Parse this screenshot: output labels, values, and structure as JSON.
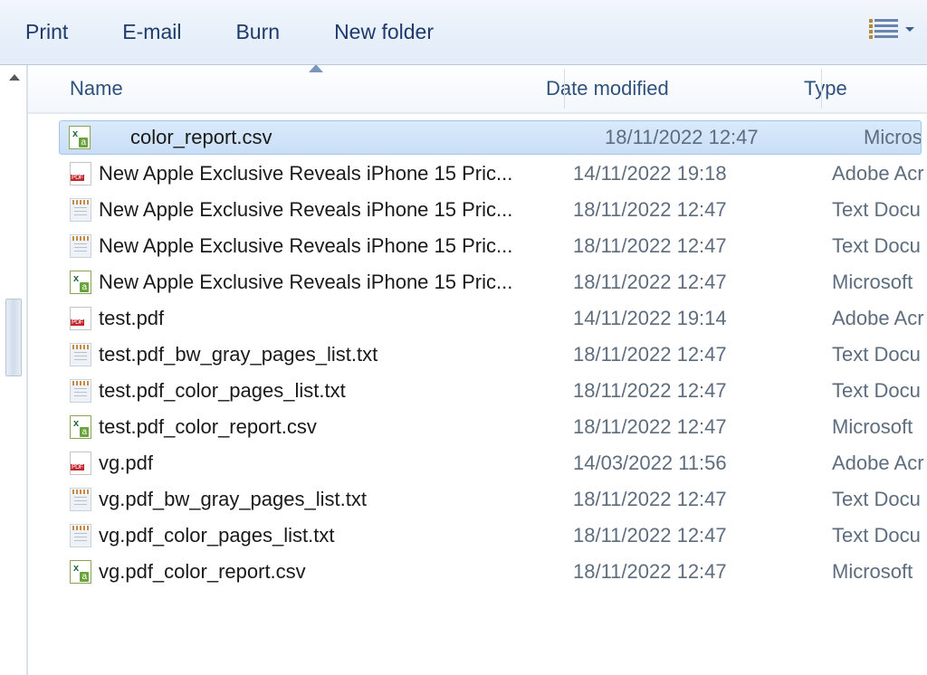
{
  "toolbar": {
    "print": "Print",
    "email": "E-mail",
    "burn": "Burn",
    "new_folder": "New folder"
  },
  "columns": {
    "name": "Name",
    "date": "Date modified",
    "type": "Type"
  },
  "files": [
    {
      "icon": "csv",
      "name": "color_report.csv",
      "date": "18/11/2022 12:47",
      "type": "Microsoft ",
      "selected": true
    },
    {
      "icon": "pdf",
      "name": "New Apple Exclusive Reveals iPhone 15 Pric...",
      "date": "14/11/2022 19:18",
      "type": "Adobe Acr"
    },
    {
      "icon": "txt",
      "name": "New Apple Exclusive Reveals iPhone 15 Pric...",
      "date": "18/11/2022 12:47",
      "type": "Text Docu"
    },
    {
      "icon": "txt",
      "name": "New Apple Exclusive Reveals iPhone 15 Pric...",
      "date": "18/11/2022 12:47",
      "type": "Text Docu"
    },
    {
      "icon": "csv",
      "name": "New Apple Exclusive Reveals iPhone 15 Pric...",
      "date": "18/11/2022 12:47",
      "type": "Microsoft "
    },
    {
      "icon": "pdf",
      "name": "test.pdf",
      "date": "14/11/2022 19:14",
      "type": "Adobe Acr"
    },
    {
      "icon": "txt",
      "name": "test.pdf_bw_gray_pages_list.txt",
      "date": "18/11/2022 12:47",
      "type": "Text Docu"
    },
    {
      "icon": "txt",
      "name": "test.pdf_color_pages_list.txt",
      "date": "18/11/2022 12:47",
      "type": "Text Docu"
    },
    {
      "icon": "csv",
      "name": "test.pdf_color_report.csv",
      "date": "18/11/2022 12:47",
      "type": "Microsoft "
    },
    {
      "icon": "pdf",
      "name": "vg.pdf",
      "date": "14/03/2022 11:56",
      "type": "Adobe Acr"
    },
    {
      "icon": "txt",
      "name": "vg.pdf_bw_gray_pages_list.txt",
      "date": "18/11/2022 12:47",
      "type": "Text Docu"
    },
    {
      "icon": "txt",
      "name": "vg.pdf_color_pages_list.txt",
      "date": "18/11/2022 12:47",
      "type": "Text Docu"
    },
    {
      "icon": "csv",
      "name": "vg.pdf_color_report.csv",
      "date": "18/11/2022 12:47",
      "type": "Microsoft "
    }
  ]
}
